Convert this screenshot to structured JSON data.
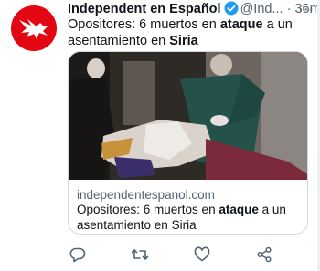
{
  "tweet": {
    "author_name": "Independent en Español",
    "handle": "@Ind...",
    "separator": "·",
    "time": "36min",
    "more": "···",
    "text_parts": [
      "Opositores: 6 muertos en ",
      "ataque",
      " a un asentamiento en ",
      "Siria"
    ]
  },
  "card": {
    "domain": "independentespanol.com",
    "title_parts": [
      "Opositores: 6 muertos en ",
      "ataque",
      " a un asentamiento en Siria"
    ]
  },
  "actions": [
    "reply-icon",
    "retweet-icon",
    "like-icon",
    "share-icon"
  ],
  "colors": {
    "brand_red": "#e30613",
    "verified_blue": "#1d9bf0",
    "muted": "#536471",
    "border": "#cfd9de"
  }
}
